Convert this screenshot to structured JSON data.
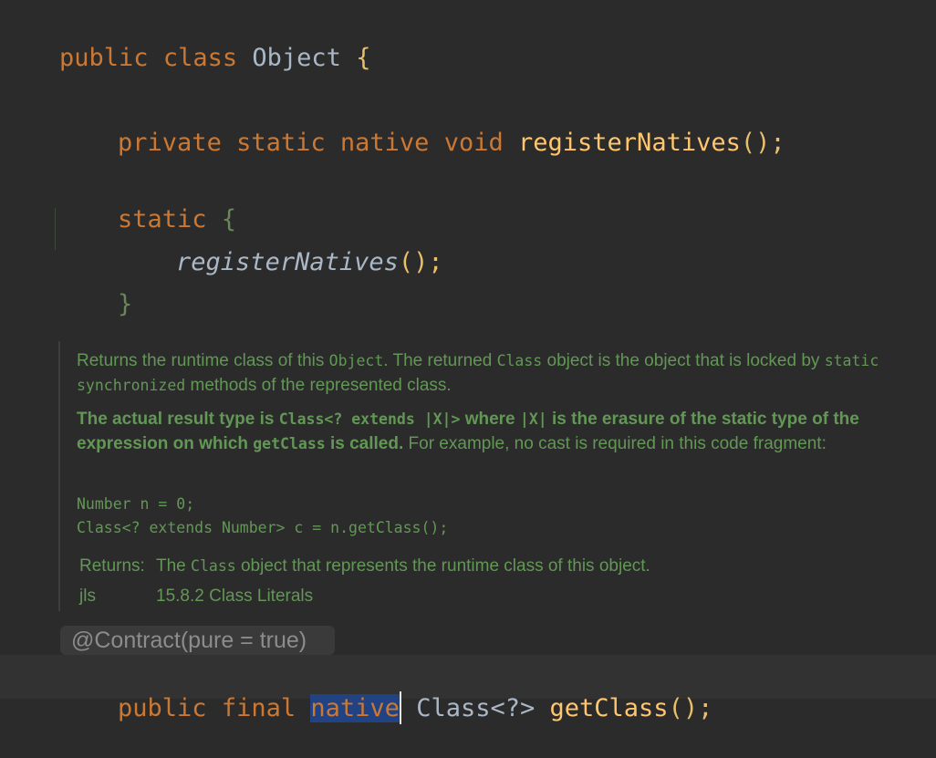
{
  "editor": {
    "line_class_decl": {
      "kw_public": "public",
      "kw_class": "class",
      "name": "Object",
      "brace": "{"
    },
    "line_register": {
      "kw_private": "private",
      "kw_static": "static",
      "kw_native": "native",
      "kw_void": "void",
      "method": "registerNatives",
      "tail": "();"
    },
    "line_static_block": {
      "kw_static": "static",
      "brace": "{"
    },
    "line_call": {
      "method": "registerNatives",
      "tail": "();"
    },
    "line_close_brace": "}",
    "javadoc": {
      "p1_a": "Returns the runtime class of this ",
      "p1_code1": "Object",
      "p1_b": ". The returned ",
      "p1_code2": "Class",
      "p1_c": " object is the object that is locked by ",
      "p1_code3": "static synchronized",
      "p1_d": " methods of the represented class.",
      "p2_bold_a": "The actual result type is ",
      "p2_code1": "Class<? extends |X|>",
      "p2_bold_b": " where ",
      "p2_code2": "|X|",
      "p2_bold_c": " is the erasure of the static type of the expression on which ",
      "p2_code3": "getClass",
      "p2_bold_d": " is called.",
      "p2_rest": " For example, no cast is required in this code fragment:",
      "pre_line1": "Number n = 0;",
      "pre_line2": "Class<? extends Number> c = n.getClass();",
      "returns_key": "Returns:",
      "returns_a": "The ",
      "returns_code": "Class",
      "returns_b": " object that represents the runtime class of this object.",
      "jls_key": "jls",
      "jls_val": "15.8.2 Class Literals"
    },
    "annotation": "@Contract(pure = true)",
    "line_getclass": {
      "kw_public": "public",
      "kw_final": "final",
      "kw_native": "native",
      "type": "Class<?>",
      "method": "getClass",
      "tail": "();"
    }
  }
}
